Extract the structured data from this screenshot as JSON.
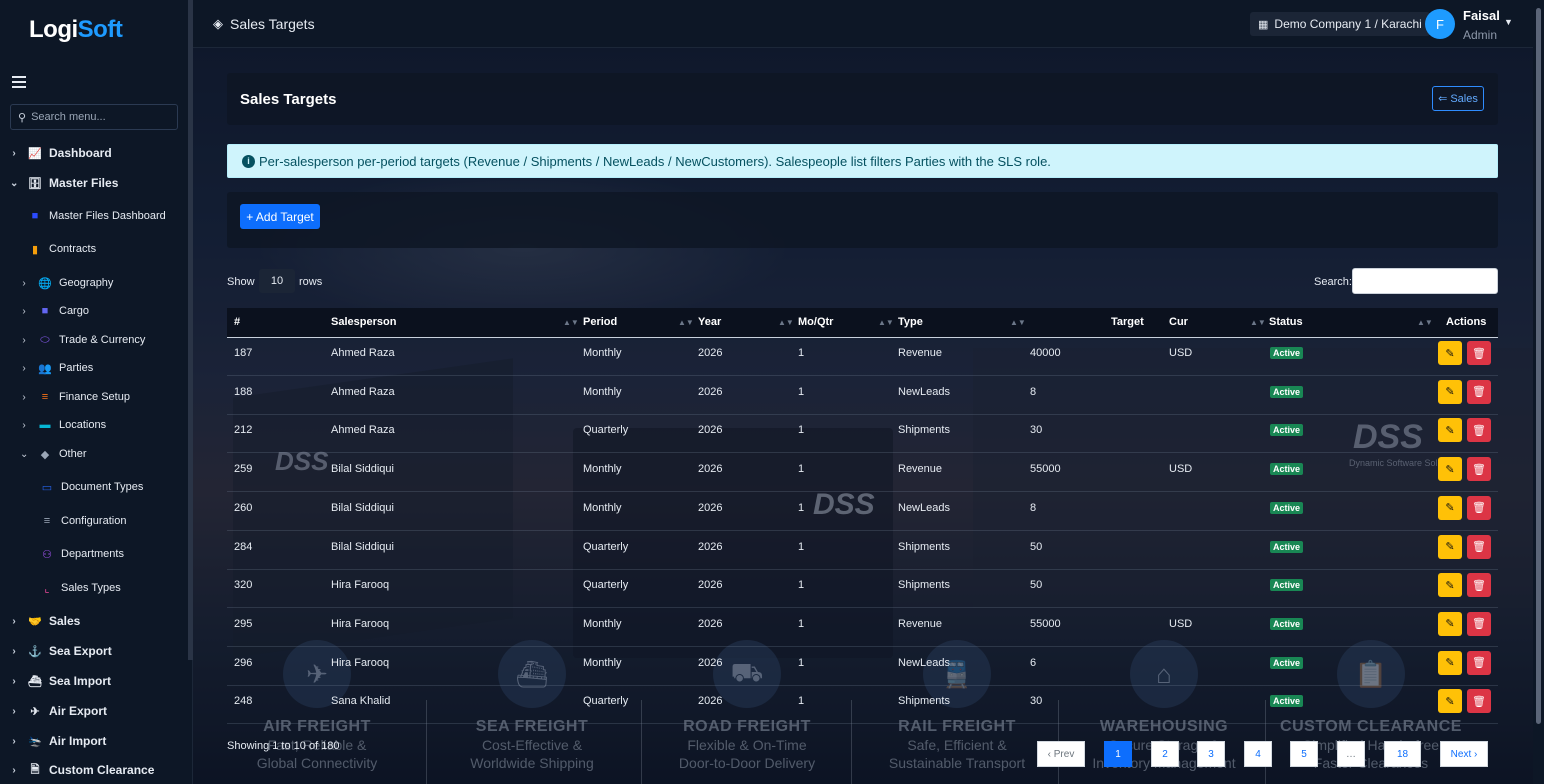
{
  "app": {
    "logo_part1": "Logi",
    "logo_part2": "Soft"
  },
  "sidebar": {
    "search_placeholder": "Search menu...",
    "items": [
      {
        "label": "Dashboard",
        "icon": "chart-line-icon",
        "glyph": "📈",
        "color": "#e6ebf2"
      },
      {
        "label": "Master Files",
        "icon": "database-icon",
        "glyph": "🗄",
        "color": "#e6ebf2"
      },
      {
        "label": "Master Files Dashboard",
        "icon": "dashboard-icon",
        "glyph": "■",
        "color": "#2b4bff"
      },
      {
        "label": "Contracts",
        "icon": "contract-icon",
        "glyph": "▮",
        "color": "#f59e0b"
      },
      {
        "label": "Geography",
        "icon": "globe-icon",
        "glyph": "🌐",
        "color": "#3b82f6"
      },
      {
        "label": "Cargo",
        "icon": "cargo-icon",
        "glyph": "■",
        "color": "#6366f1"
      },
      {
        "label": "Trade & Currency",
        "icon": "handshake-icon",
        "glyph": "⬭",
        "color": "#8b5cf6"
      },
      {
        "label": "Parties",
        "icon": "users-icon",
        "glyph": "👥",
        "color": "#22c55e"
      },
      {
        "label": "Finance Setup",
        "icon": "coins-icon",
        "glyph": "≡",
        "color": "#f97316"
      },
      {
        "label": "Locations",
        "icon": "warehouse-icon",
        "glyph": "▬",
        "color": "#06b6d4"
      },
      {
        "label": "Other",
        "icon": "tags-icon",
        "glyph": "◆",
        "color": "#9aa6b6"
      },
      {
        "label": "Document Types",
        "icon": "id-card-icon",
        "glyph": "▭",
        "color": "#2563eb"
      },
      {
        "label": "Configuration",
        "icon": "sliders-icon",
        "glyph": "≡",
        "color": "#9aa6b6"
      },
      {
        "label": "Departments",
        "icon": "sitemap-icon",
        "glyph": "⚇",
        "color": "#a855f7"
      },
      {
        "label": "Sales Types",
        "icon": "chart-icon",
        "glyph": "⌞",
        "color": "#ec4899"
      },
      {
        "label": "Sales",
        "icon": "handshake-icon",
        "glyph": "🤝",
        "color": "#e6ebf2"
      },
      {
        "label": "Sea Export",
        "icon": "anchor-icon",
        "glyph": "⚓",
        "color": "#e6ebf2"
      },
      {
        "label": "Sea Import",
        "icon": "ship-icon",
        "glyph": "⛴",
        "color": "#e6ebf2"
      },
      {
        "label": "Air Export",
        "icon": "plane-icon",
        "glyph": "✈",
        "color": "#e6ebf2"
      },
      {
        "label": "Air Import",
        "icon": "plane-arrival-icon",
        "glyph": "🛬",
        "color": "#e6ebf2"
      },
      {
        "label": "Custom Clearance",
        "icon": "file-icon",
        "glyph": "🗎",
        "color": "#e6ebf2"
      }
    ]
  },
  "header": {
    "title": "Sales Targets",
    "company": "Demo Company 1 / Karachi",
    "user_initial": "F",
    "user_name": "Faisal",
    "user_role": "Admin"
  },
  "page": {
    "title": "Sales Targets",
    "back_button": "Sales",
    "info_text": "Per-salesperson per-period targets (Revenue / Shipments / NewLeads / NewCustomers). Salespeople list filters Parties with the SLS role.",
    "add_button": "+ Add Target",
    "show_label": "Show",
    "page_size": "10",
    "rows_label": "rows",
    "search_label": "Search:",
    "showing_text": "Showing 1 to 10 of 180"
  },
  "table": {
    "headers": [
      "#",
      "Salesperson",
      "Period",
      "Year",
      "Mo/Qtr",
      "Type",
      "Target",
      "Cur",
      "Status",
      "Actions"
    ],
    "rows": [
      {
        "id": "187",
        "salesperson": "Ahmed Raza",
        "period": "Monthly",
        "year": "2026",
        "moqtr": "1",
        "type": "Revenue",
        "target": "40000",
        "cur": "USD",
        "status": "Active"
      },
      {
        "id": "188",
        "salesperson": "Ahmed Raza",
        "period": "Monthly",
        "year": "2026",
        "moqtr": "1",
        "type": "NewLeads",
        "target": "8",
        "cur": "",
        "status": "Active"
      },
      {
        "id": "212",
        "salesperson": "Ahmed Raza",
        "period": "Quarterly",
        "year": "2026",
        "moqtr": "1",
        "type": "Shipments",
        "target": "30",
        "cur": "",
        "status": "Active"
      },
      {
        "id": "259",
        "salesperson": "Bilal Siddiqui",
        "period": "Monthly",
        "year": "2026",
        "moqtr": "1",
        "type": "Revenue",
        "target": "55000",
        "cur": "USD",
        "status": "Active"
      },
      {
        "id": "260",
        "salesperson": "Bilal Siddiqui",
        "period": "Monthly",
        "year": "2026",
        "moqtr": "1",
        "type": "NewLeads",
        "target": "8",
        "cur": "",
        "status": "Active"
      },
      {
        "id": "284",
        "salesperson": "Bilal Siddiqui",
        "period": "Quarterly",
        "year": "2026",
        "moqtr": "1",
        "type": "Shipments",
        "target": "50",
        "cur": "",
        "status": "Active"
      },
      {
        "id": "320",
        "salesperson": "Hira Farooq",
        "period": "Quarterly",
        "year": "2026",
        "moqtr": "1",
        "type": "Shipments",
        "target": "50",
        "cur": "",
        "status": "Active"
      },
      {
        "id": "295",
        "salesperson": "Hira Farooq",
        "period": "Monthly",
        "year": "2026",
        "moqtr": "1",
        "type": "Revenue",
        "target": "55000",
        "cur": "USD",
        "status": "Active"
      },
      {
        "id": "296",
        "salesperson": "Hira Farooq",
        "period": "Monthly",
        "year": "2026",
        "moqtr": "1",
        "type": "NewLeads",
        "target": "6",
        "cur": "",
        "status": "Active"
      },
      {
        "id": "248",
        "salesperson": "Sana Khalid",
        "period": "Quarterly",
        "year": "2026",
        "moqtr": "1",
        "type": "Shipments",
        "target": "30",
        "cur": "",
        "status": "Active"
      }
    ]
  },
  "pagination": {
    "prev": "‹ Prev",
    "pages": [
      "1",
      "2",
      "3",
      "4",
      "5",
      "…",
      "18"
    ],
    "next": "Next ›"
  },
  "services": [
    {
      "title": "AIR FREIGHT",
      "line1": "Fast, Reliable &",
      "line2": "Global Connectivity",
      "icon": "plane-icon"
    },
    {
      "title": "SEA FREIGHT",
      "line1": "Cost-Effective &",
      "line2": "Worldwide Shipping",
      "icon": "ship-icon"
    },
    {
      "title": "ROAD FREIGHT",
      "line1": "Flexible & On-Time",
      "line2": "Door-to-Door Delivery",
      "icon": "truck-icon"
    },
    {
      "title": "RAIL FREIGHT",
      "line1": "Safe, Efficient &",
      "line2": "Sustainable Transport",
      "icon": "train-icon"
    },
    {
      "title": "WAREHOUSING",
      "line1": "Secure Storage &",
      "line2": "Inventory Management",
      "icon": "warehouse-icon"
    },
    {
      "title": "CUSTOM CLEARANCE",
      "line1": "Simplified Hassle-free",
      "line2": "Faster Clearances",
      "icon": "clipboard-check-icon"
    }
  ],
  "watermark": {
    "brand": "DSS",
    "tagline": "Dynamic Software Solution"
  }
}
